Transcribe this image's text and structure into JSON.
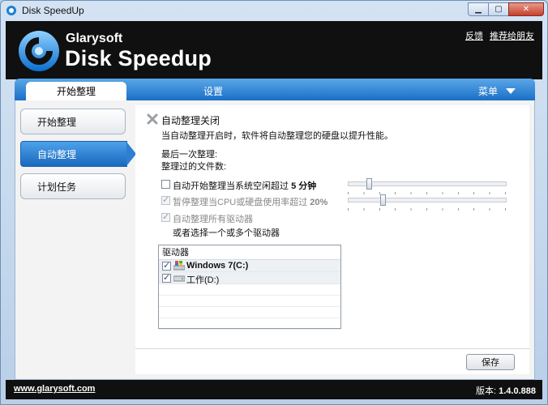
{
  "window": {
    "title": "Disk SpeedUp"
  },
  "header": {
    "brand_small": "Glarysoft",
    "brand_big": "Disk Speedup",
    "links": [
      "反馈",
      "推荐给朋友"
    ]
  },
  "tabs": {
    "active": "开始整理",
    "settings": "设置",
    "menu": "菜单"
  },
  "sidebar": {
    "items": [
      {
        "label": "开始整理"
      },
      {
        "label": "自动整理"
      },
      {
        "label": "计划任务"
      }
    ]
  },
  "main": {
    "status_title": "自动整理关闭",
    "status_desc": "当自动整理开启时，软件将自动整理您的硬盘以提升性能。",
    "last_defrag_label": "最后一次整理:",
    "files_defragged_label": "整理过的文件数:",
    "option_idle": "自动开始整理当系统空闲超过",
    "option_idle_value": "5 分钟",
    "option_pause": "暂停整理当CPU或硬盘使用率超过",
    "option_pause_value": "20%",
    "option_all_drives": "自动整理所有驱动器",
    "or_select": "或者选择一个或多个驱动器",
    "drive_header": "驱动器",
    "drives": [
      {
        "label": "Windows 7(C:)",
        "checked": true
      },
      {
        "label": "工作(D:)",
        "checked": true
      }
    ],
    "save_label": "保存",
    "idle_slider_level": 0.12,
    "pause_slider_level": 0.21
  },
  "footer": {
    "site": "www.glarysoft.com",
    "version_label": "版本:",
    "version_value": "1.4.0.888"
  }
}
